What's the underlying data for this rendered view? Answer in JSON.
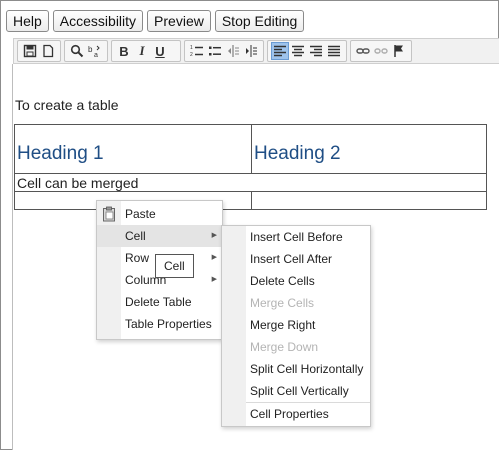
{
  "top_buttons": {
    "help": "Help",
    "accessibility": "Accessibility",
    "preview": "Preview",
    "stop_editing": "Stop Editing"
  },
  "toolbar": {
    "icons": [
      "save-icon",
      "new-page-icon",
      "find-icon",
      "replace-icon",
      "bold-icon",
      "italic-icon",
      "underline-icon",
      "numbered-list-icon",
      "bulleted-list-icon",
      "decrease-indent-icon",
      "increase-indent-icon",
      "align-left-icon",
      "align-center-icon",
      "align-right-icon",
      "justify-icon",
      "link-icon",
      "unlink-icon",
      "anchor-icon"
    ],
    "bold": "B",
    "italic": "I",
    "underline": "U",
    "active_color": "#9ec3ec"
  },
  "editor": {
    "intro_text": "To create a table",
    "table": {
      "heading_1": "Heading 1",
      "heading_2": "Heading 2",
      "merge_text": "Cell can be merged"
    }
  },
  "context_menu": {
    "items": [
      {
        "label": "Paste",
        "icon": "clipboard-icon"
      },
      {
        "label": "Cell",
        "submenu": true,
        "hover": true
      },
      {
        "label": "Row",
        "submenu": true
      },
      {
        "label": "Column",
        "submenu": true
      },
      {
        "label": "Delete Table"
      },
      {
        "label": "Table Properties"
      }
    ]
  },
  "cell_submenu": {
    "items": [
      {
        "label": "Insert Cell Before"
      },
      {
        "label": "Insert Cell After"
      },
      {
        "label": "Delete Cells"
      },
      {
        "label": "Merge Cells",
        "disabled": true
      },
      {
        "label": "Merge Right"
      },
      {
        "label": "Merge Down",
        "disabled": true
      },
      {
        "label": "Split Cell Horizontally"
      },
      {
        "label": "Split Cell Vertically"
      },
      {
        "label": "Cell Properties"
      }
    ]
  },
  "tooltip": "Cell"
}
